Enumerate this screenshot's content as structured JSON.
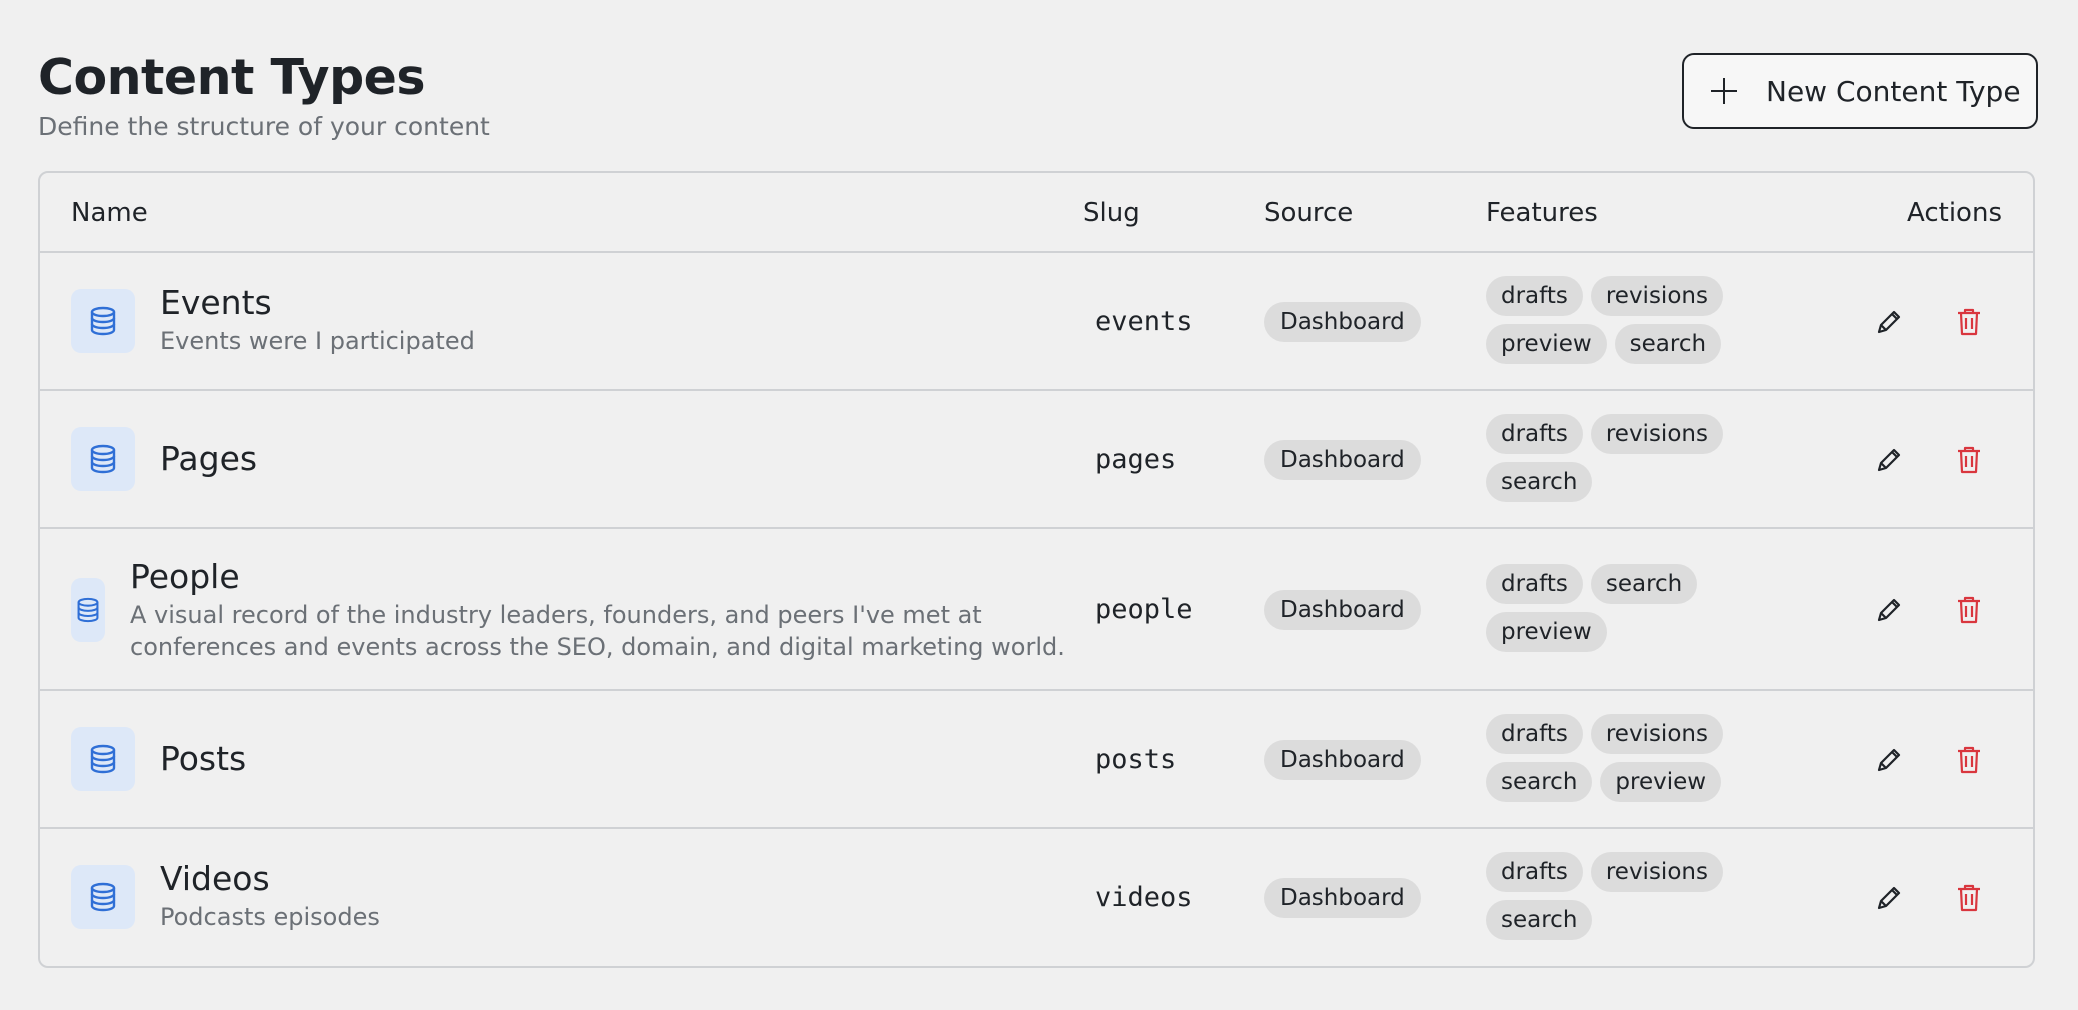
{
  "header": {
    "title": "Content Types",
    "subtitle": "Define the structure of your content",
    "new_button_label": "New Content Type"
  },
  "table": {
    "columns": {
      "name": "Name",
      "slug": "Slug",
      "source": "Source",
      "features": "Features",
      "actions": "Actions"
    },
    "rows": [
      {
        "name": "Events",
        "description": "Events were I participated",
        "slug": "events",
        "source": "Dashboard",
        "features": [
          "drafts",
          "revisions",
          "preview",
          "search"
        ],
        "icon": "database-icon"
      },
      {
        "name": "Pages",
        "description": "",
        "slug": "pages",
        "source": "Dashboard",
        "features": [
          "drafts",
          "revisions",
          "search"
        ],
        "icon": "database-icon"
      },
      {
        "name": "People",
        "description_line1": "A visual record of the industry leaders, founders, and peers I've met at",
        "description_line2": "conferences and events across the SEO, domain, and digital marketing world.",
        "slug": "people",
        "source": "Dashboard",
        "features": [
          "drafts",
          "search",
          "preview"
        ],
        "icon": "database-icon"
      },
      {
        "name": "Posts",
        "description": "",
        "slug": "posts",
        "source": "Dashboard",
        "features": [
          "drafts",
          "revisions",
          "search",
          "preview"
        ],
        "icon": "database-icon"
      },
      {
        "name": "Videos",
        "description": "Podcasts episodes",
        "slug": "videos",
        "source": "Dashboard",
        "features": [
          "drafts",
          "revisions",
          "search"
        ],
        "icon": "database-icon"
      }
    ]
  },
  "colors": {
    "background": "#f0f0f0",
    "icon_blue": "#2f6fd6",
    "icon_bg": "#dde8f8",
    "delete_red": "#d9363e",
    "chip_bg": "#dcdcdc",
    "border": "#cfd1d4"
  }
}
